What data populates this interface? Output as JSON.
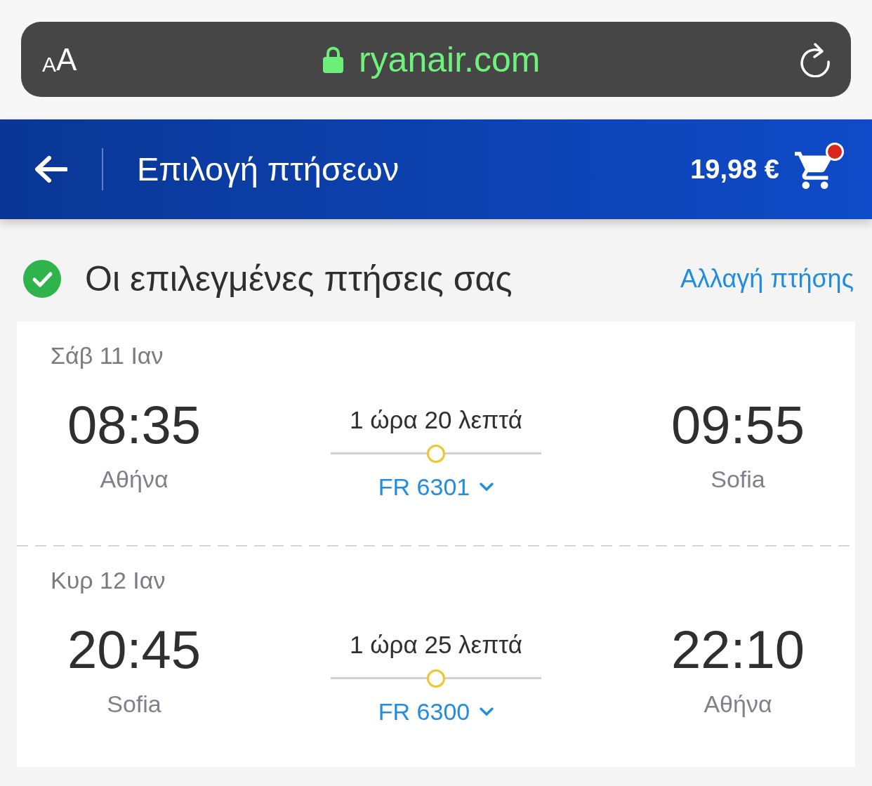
{
  "browser": {
    "text_size_button": "AA",
    "url": "ryanair.com"
  },
  "header": {
    "title": "Επιλογή πτήσεων",
    "price": "19,98 €",
    "cart_badge": true
  },
  "section": {
    "title": "Οι επιλεγμένες πτήσεις σας",
    "change_link": "Αλλαγή πτήσης"
  },
  "flights": [
    {
      "date": "Σάβ 11 Ιαν",
      "departure_time": "08:35",
      "departure_city": "Αθήνα",
      "duration": "1 ώρα 20 λεπτά",
      "flight_number": "FR 6301",
      "expanded": false,
      "arrival_time": "09:55",
      "arrival_city": "Sofia"
    },
    {
      "date": "Κυρ 12 Ιαν",
      "departure_time": "20:45",
      "departure_city": "Sofia",
      "duration": "1 ώρα 25 λεπτά",
      "flight_number": "FR 6300",
      "expanded": false,
      "arrival_time": "22:10",
      "arrival_city": "Αθήνα"
    }
  ]
}
